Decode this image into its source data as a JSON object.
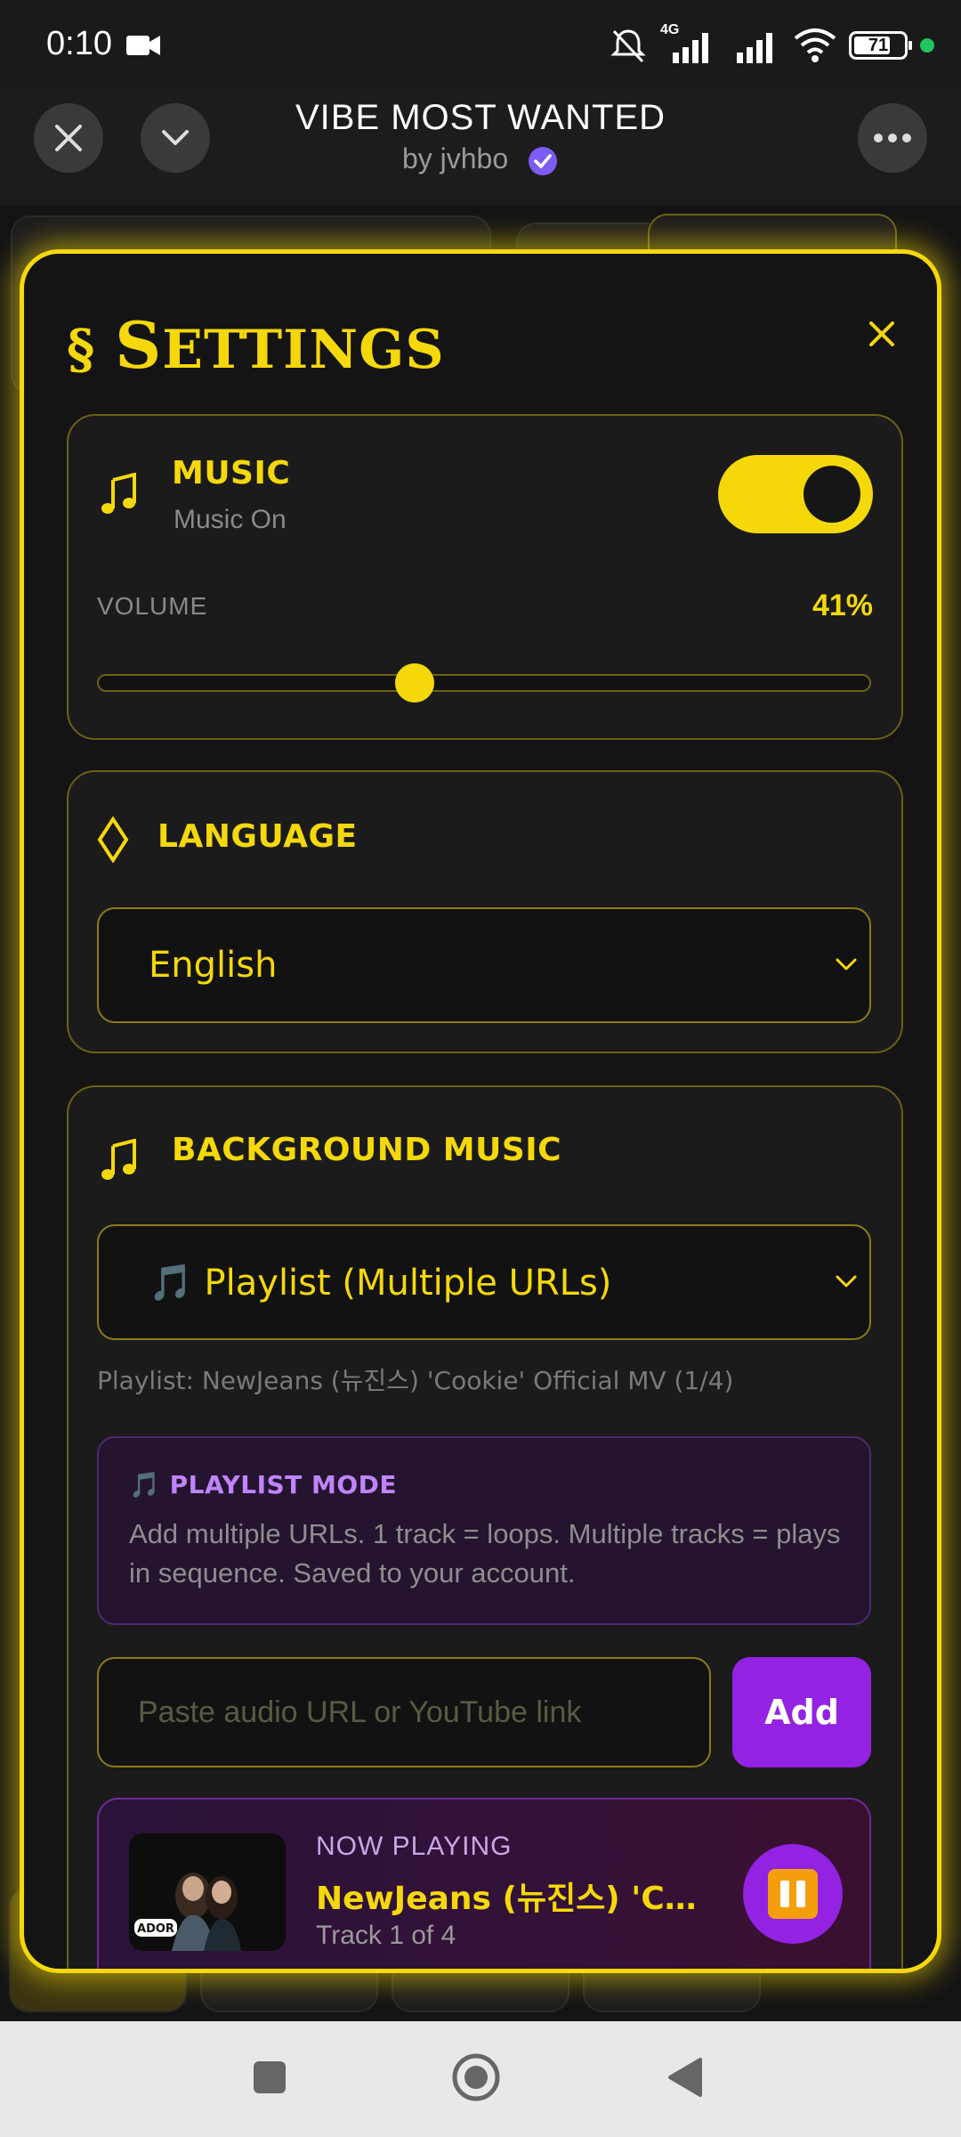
{
  "status_bar": {
    "time": "0:10",
    "network": "4G",
    "battery": "71",
    "icons": [
      "video-camera-icon",
      "mute-vibrate-icon",
      "signal-icon",
      "signal-icon",
      "wifi-icon",
      "battery-icon",
      "dot-icon"
    ]
  },
  "header": {
    "title": "VIBE MOST WANTED",
    "subtitle": "by jvhbo",
    "icons": [
      "close-icon",
      "chevron-down-icon",
      "verified-icon",
      "more-icon"
    ]
  },
  "settings": {
    "title_mark": "§",
    "title_first": "S",
    "title_rest": "ETTINGS",
    "music": {
      "label": "MUSIC",
      "status": "Music On",
      "toggle_on": true,
      "volume_label": "VOLUME",
      "volume_value": "41%",
      "volume_fraction": 0.41
    },
    "language": {
      "label": "LANGUAGE",
      "selected": "English"
    },
    "background_music": {
      "label": "BACKGROUND MUSIC",
      "selected": "🎵 Playlist (Multiple URLs)",
      "playlist_note": "Playlist: NewJeans (뉴진스) 'Cookie' Official MV (1/4)",
      "mode_title": "🎵 PLAYLIST MODE",
      "mode_text": "Add multiple URLs. 1 track = loops. Multiple tracks = plays in sequence. Saved to your account.",
      "input_placeholder": "Paste audio URL or YouTube link",
      "add_label": "Add",
      "now_playing_label": "NOW PLAYING",
      "now_playing_title": "NewJeans (뉴진스) 'Coo...",
      "now_playing_track": "Track 1 of 4"
    }
  },
  "colors": {
    "accent": "#f5d80a",
    "purple": "#9322e2",
    "background": "#141414"
  }
}
